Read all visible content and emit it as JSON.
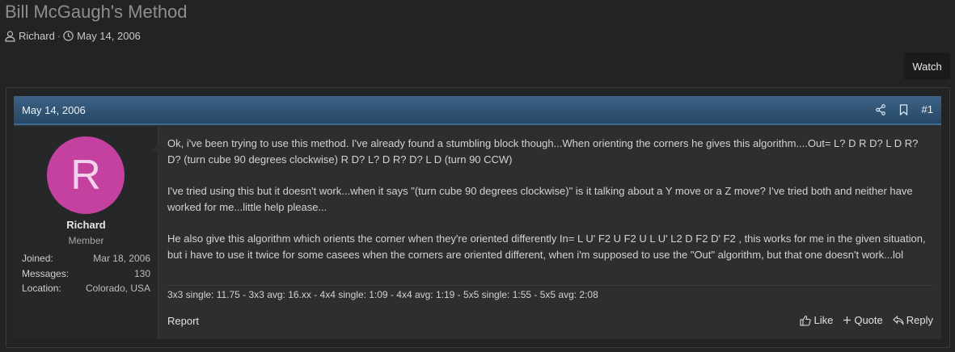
{
  "thread": {
    "title": "Bill McGaugh's Method",
    "author": "Richard",
    "separator": "·",
    "date": "May 14, 2006",
    "watch_label": "Watch"
  },
  "post": {
    "date": "May 14, 2006",
    "number": "#1",
    "user": {
      "avatar_letter": "R",
      "avatar_color": "#c4419f",
      "name": "Richard",
      "title": "Member",
      "stats": [
        {
          "label": "Joined:",
          "value": "Mar 18, 2006"
        },
        {
          "label": "Messages:",
          "value": "130"
        },
        {
          "label": "Location:",
          "value": "Colorado, USA"
        }
      ]
    },
    "paragraphs": [
      "Ok, i've been trying to use this method. I've already found a stumbling block though...When orienting the corners he gives this algorithm....Out= L? D R D? L D R? D? (turn cube 90 degrees clockwise) R D? L? D R? D? L D (turn 90 CCW)",
      "I've tried using this but it doesn't work...when it says \"(turn cube 90 degrees clockwise)\" is it talking about a Y move or a Z move? I've tried both and neither have worked for me...little help please...",
      "He also give this algorithm which orients the corner when they're oriented differently In= L U' F2 U F2 U L U' L2 D F2 D' F2 , this works for me in the given situation, but i have to use it twice for some casees when the corners are oriented different, when i'm supposed to use the \"Out\" algorithm, but that one doesn't work...lol"
    ],
    "signature": "3x3 single: 11.75 - 3x3 avg: 16.xx - 4x4 single: 1:09 - 4x4 avg: 1:19 - 5x5 single: 1:55 - 5x5 avg: 2:08",
    "footer": {
      "report": "Report",
      "like": "Like",
      "quote": "Quote",
      "reply": "Reply"
    }
  },
  "colors": {
    "background": "#222324",
    "header_blue": "#2f5577",
    "post_background": "#2d2e30"
  }
}
